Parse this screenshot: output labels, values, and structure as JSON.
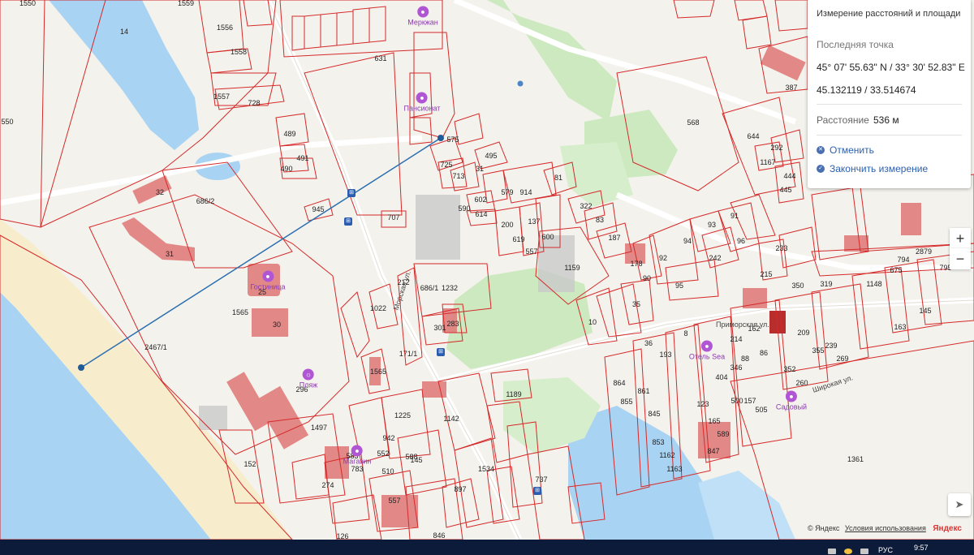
{
  "map": {
    "parcels": [
      "1550",
      "14",
      "1559",
      "1556",
      "1558",
      "1557",
      "728",
      "550",
      "631",
      "489",
      "491",
      "490",
      "945",
      "707",
      "686/2",
      "32",
      "31",
      "29",
      "25",
      "30",
      "1565",
      "296",
      "1497",
      "152",
      "274",
      "2467/1",
      "1022",
      "212",
      "171/1",
      "1565",
      "283",
      "301",
      "686/1",
      "1232",
      "568",
      "644",
      "1167",
      "444",
      "445",
      "292",
      "387",
      "575",
      "725",
      "713",
      "31",
      "495",
      "914",
      "602",
      "614",
      "590",
      "579",
      "200",
      "619",
      "557",
      "137",
      "600",
      "81",
      "322",
      "83",
      "187",
      "1159",
      "93",
      "91",
      "94",
      "92",
      "96",
      "242",
      "95",
      "90",
      "178",
      "35",
      "10",
      "36",
      "193",
      "8",
      "864",
      "861",
      "855",
      "845",
      "853",
      "1162",
      "1163",
      "165",
      "123",
      "589",
      "847",
      "1361",
      "1189",
      "1142",
      "1534",
      "897",
      "737",
      "557",
      "510",
      "588",
      "942",
      "126",
      "846",
      "583",
      "783",
      "1225",
      "145",
      "552",
      "233",
      "215",
      "350",
      "319",
      "1148",
      "675",
      "794",
      "2879",
      "795",
      "145",
      "163",
      "239",
      "269",
      "355",
      "352",
      "260",
      "209",
      "214",
      "162",
      "86",
      "88",
      "346",
      "404",
      "500",
      "157",
      "505"
    ],
    "streets": [
      "Морская ул.",
      "Приморская ул.",
      "Широкая ул."
    ],
    "pois": [
      {
        "name": "Меркжан",
        "icon": "pin-icon"
      },
      {
        "name": "Пансионат",
        "icon": "pin-icon"
      },
      {
        "name": "Гостиница",
        "icon": "pin-icon"
      },
      {
        "name": "Пляж",
        "icon": "beach-icon"
      },
      {
        "name": "Магазин",
        "icon": "pin-icon"
      },
      {
        "name": "Отель Sea",
        "icon": "pin-icon"
      },
      {
        "name": "Садовый",
        "icon": "pin-icon"
      }
    ]
  },
  "panel": {
    "title": "Измерение расстояний и площади",
    "section_label": "Последняя точка",
    "coord_dms": "45° 07' 55.63\" N / 33° 30' 52.83\" E",
    "coord_decimal": "45.132119 / 33.514674",
    "distance_label": "Расстояние",
    "distance_value": "536 м",
    "cancel_label": "Отменить",
    "finish_label": "Закончить измерение"
  },
  "controls": {
    "zoom_in": "+",
    "zoom_out": "−"
  },
  "attribution": {
    "copyright": "© Яндекс",
    "terms": "Условия использования",
    "logo": "Яндекс"
  },
  "taskbar": {
    "lang": "РУС",
    "time": "9:57"
  },
  "colors": {
    "parcel_border": "#d42a2a",
    "water": "#a9d3f2",
    "park": "#cde9c0",
    "building": "#e07d7d",
    "measure_line": "#2a6fb0"
  }
}
